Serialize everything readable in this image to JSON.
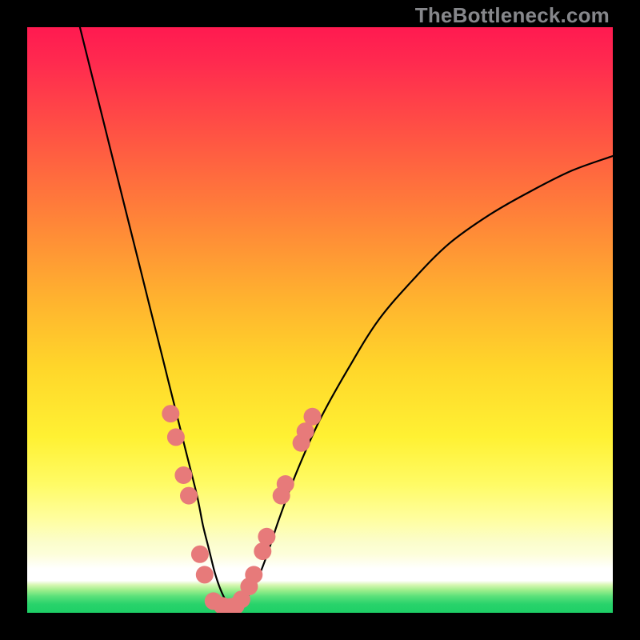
{
  "watermark": "TheBottleneck.com",
  "colors": {
    "frame_bg": "#000000",
    "curve_stroke": "#000000",
    "marker_fill": "#e77a7a",
    "marker_fill_alt": "#d86f71",
    "bottom_band": "#29d36b",
    "white_band": "#ffffff",
    "pale_band": "#fbfdcc"
  },
  "gradient_css": "linear-gradient(to bottom, #ff1a50 0%, #ff2a4f 6%, #ff5244 18%, #ff8139 32%, #ffb12f 46%, #ffd62a 58%, #fff133 70%, #fffb65 78%, #fffe9f 84%, #fbfdcc 88%, #fdfeda 90%, #ffffff 92.5%, #ffffff 94.5%, #d9f7b5 95.2%, #a6f08f 96%, #5ae07a 97.2%, #29d36b 98.5%, #1ecf66 100%)",
  "chart_data": {
    "type": "line",
    "title": "",
    "xlabel": "",
    "ylabel": "",
    "xlim": [
      0,
      100
    ],
    "ylim": [
      0,
      100
    ],
    "grid": false,
    "legend": false,
    "series": [
      {
        "name": "bottleneck-curve",
        "x": [
          9,
          11,
          13,
          15,
          17,
          19,
          21,
          23,
          25,
          27,
          29,
          30,
          31,
          32,
          33,
          34,
          35,
          37,
          39,
          41,
          43,
          46,
          50,
          55,
          60,
          66,
          72,
          79,
          86,
          93,
          100
        ],
        "y": [
          100,
          92,
          84,
          76,
          68,
          60,
          52,
          44,
          36,
          28,
          20,
          15,
          11,
          7,
          4,
          2,
          1,
          2,
          5,
          10,
          16,
          24,
          33,
          42,
          50,
          57,
          63,
          68,
          72,
          75.5,
          78
        ]
      }
    ],
    "markers": [
      {
        "x": 24.5,
        "y": 34
      },
      {
        "x": 25.4,
        "y": 30
      },
      {
        "x": 26.7,
        "y": 23.5
      },
      {
        "x": 27.6,
        "y": 20
      },
      {
        "x": 29.5,
        "y": 10
      },
      {
        "x": 30.3,
        "y": 6.5
      },
      {
        "x": 31.8,
        "y": 2
      },
      {
        "x": 33.3,
        "y": 1.2
      },
      {
        "x": 34.6,
        "y": 1
      },
      {
        "x": 35.6,
        "y": 1.2
      },
      {
        "x": 36.6,
        "y": 2.3
      },
      {
        "x": 37.9,
        "y": 4.5
      },
      {
        "x": 38.7,
        "y": 6.5
      },
      {
        "x": 40.2,
        "y": 10.5
      },
      {
        "x": 40.9,
        "y": 13
      },
      {
        "x": 43.4,
        "y": 20
      },
      {
        "x": 44.1,
        "y": 22
      },
      {
        "x": 46.8,
        "y": 29
      },
      {
        "x": 47.5,
        "y": 31
      },
      {
        "x": 48.7,
        "y": 33.5
      }
    ],
    "annotations": []
  }
}
